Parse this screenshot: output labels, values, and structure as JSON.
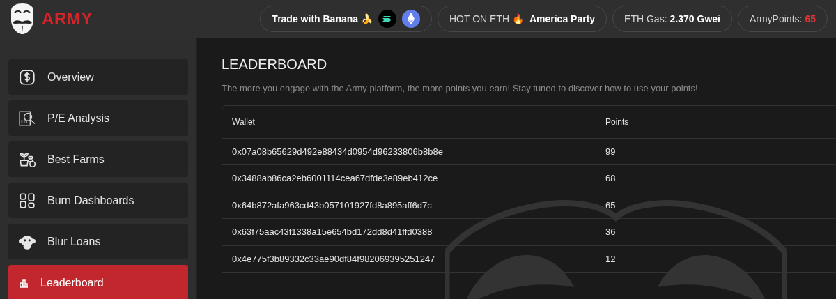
{
  "header": {
    "logo": "ARMY",
    "banana": "Trade with Banana 🍌",
    "hot_label": "HOT ON ETH 🔥",
    "hot_value": "America Party",
    "gas_label": "ETH Gas:",
    "gas_value": "2.370 Gwei",
    "points_label": "ArmyPoints:",
    "points_value": "65"
  },
  "sidebar": {
    "items": [
      {
        "label": "Overview",
        "kind": "dollar",
        "selected": false
      },
      {
        "label": "P/E Analysis",
        "kind": "analysis",
        "selected": false
      },
      {
        "label": "Best Farms",
        "kind": "farm",
        "selected": false
      },
      {
        "label": "Burn Dashboards",
        "kind": "grid",
        "selected": false
      },
      {
        "label": "Blur Loans",
        "kind": "monkey",
        "selected": false
      },
      {
        "label": "Leaderboard",
        "kind": "chart",
        "selected": true
      }
    ]
  },
  "page": {
    "title": "LEADERBOARD",
    "description": "The more you engage with the Army platform, the more points you earn! Stay tuned to discover how to use your points!"
  },
  "table": {
    "columns": [
      "Wallet",
      "Points"
    ],
    "rows": [
      [
        "0x07a08b65629d492e88434d0954d96233806b8b8e",
        "99"
      ],
      [
        "0x3488ab86ca2eb6001114cea67dfde3e89eb412ce",
        "68"
      ],
      [
        "0x64b872afa963cd43b057101927fd8a895aff6d7c",
        "65"
      ],
      [
        "0x63f75aac43f1338a15e654bd172dd8d41ffd0388",
        "36"
      ],
      [
        "0x4e775f3b89332c33ae90df84f982069395251247",
        "12"
      ]
    ]
  }
}
